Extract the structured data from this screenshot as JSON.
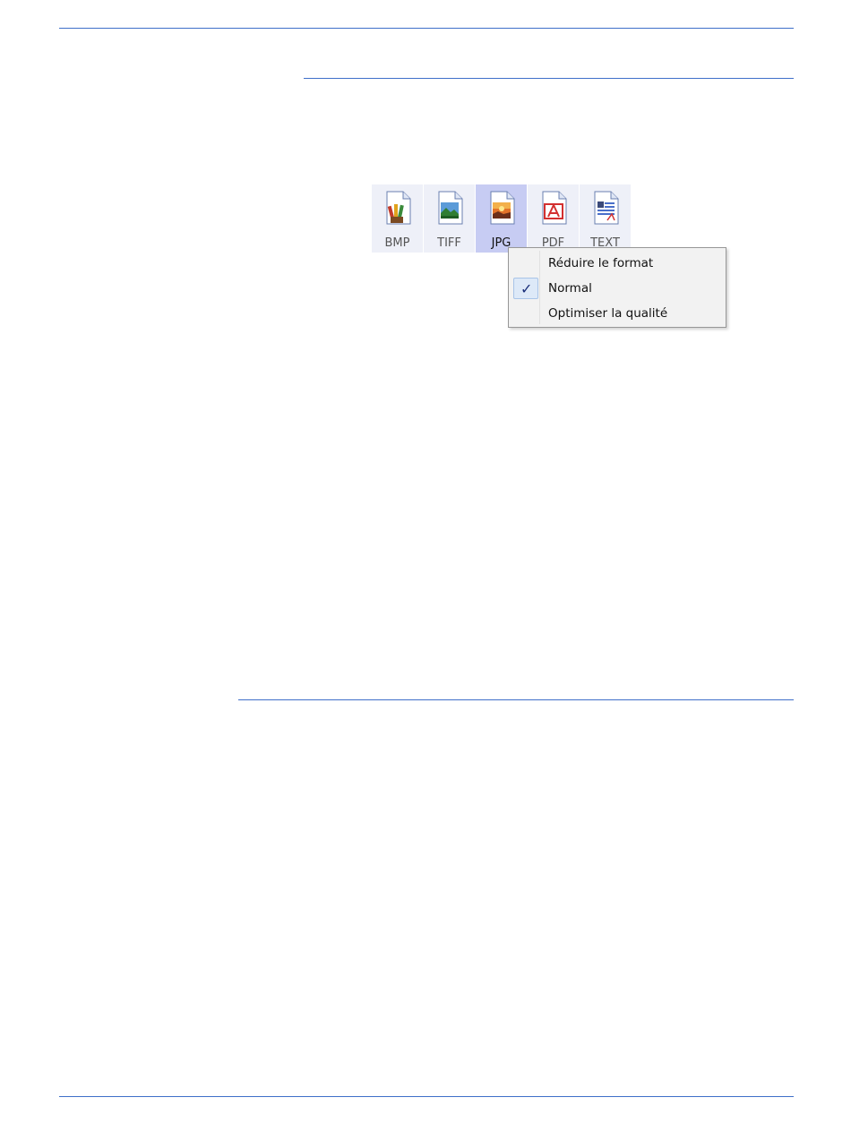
{
  "format_bar": {
    "buttons": [
      {
        "label": "BMP",
        "icon": "bmp-file-icon",
        "selected": false
      },
      {
        "label": "TIFF",
        "icon": "tiff-file-icon",
        "selected": false
      },
      {
        "label": "JPG",
        "icon": "jpg-file-icon",
        "selected": true
      },
      {
        "label": "PDF",
        "icon": "pdf-file-icon",
        "selected": false
      },
      {
        "label": "TEXT",
        "icon": "text-file-icon",
        "selected": false
      }
    ]
  },
  "context_menu": {
    "items": [
      {
        "label": "Réduire le format",
        "checked": false
      },
      {
        "label": "Normal",
        "checked": true
      },
      {
        "label": "Optimiser la qualité",
        "checked": false
      }
    ],
    "check_glyph": "✓"
  },
  "colors": {
    "rule": "#3f6fc9",
    "selected_button": "#c7ccf3",
    "button_bg": "#eef0f8",
    "menu_bg": "#f2f2f2",
    "check_highlight": "#dde9f8"
  }
}
